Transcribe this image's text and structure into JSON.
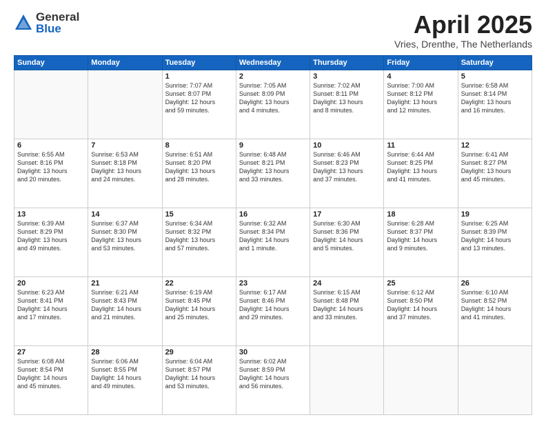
{
  "header": {
    "logo_general": "General",
    "logo_blue": "Blue",
    "month_title": "April 2025",
    "subtitle": "Vries, Drenthe, The Netherlands"
  },
  "days_of_week": [
    "Sunday",
    "Monday",
    "Tuesday",
    "Wednesday",
    "Thursday",
    "Friday",
    "Saturday"
  ],
  "weeks": [
    [
      {
        "day": "",
        "info": ""
      },
      {
        "day": "",
        "info": ""
      },
      {
        "day": "1",
        "info": "Sunrise: 7:07 AM\nSunset: 8:07 PM\nDaylight: 12 hours\nand 59 minutes."
      },
      {
        "day": "2",
        "info": "Sunrise: 7:05 AM\nSunset: 8:09 PM\nDaylight: 13 hours\nand 4 minutes."
      },
      {
        "day": "3",
        "info": "Sunrise: 7:02 AM\nSunset: 8:11 PM\nDaylight: 13 hours\nand 8 minutes."
      },
      {
        "day": "4",
        "info": "Sunrise: 7:00 AM\nSunset: 8:12 PM\nDaylight: 13 hours\nand 12 minutes."
      },
      {
        "day": "5",
        "info": "Sunrise: 6:58 AM\nSunset: 8:14 PM\nDaylight: 13 hours\nand 16 minutes."
      }
    ],
    [
      {
        "day": "6",
        "info": "Sunrise: 6:55 AM\nSunset: 8:16 PM\nDaylight: 13 hours\nand 20 minutes."
      },
      {
        "day": "7",
        "info": "Sunrise: 6:53 AM\nSunset: 8:18 PM\nDaylight: 13 hours\nand 24 minutes."
      },
      {
        "day": "8",
        "info": "Sunrise: 6:51 AM\nSunset: 8:20 PM\nDaylight: 13 hours\nand 28 minutes."
      },
      {
        "day": "9",
        "info": "Sunrise: 6:48 AM\nSunset: 8:21 PM\nDaylight: 13 hours\nand 33 minutes."
      },
      {
        "day": "10",
        "info": "Sunrise: 6:46 AM\nSunset: 8:23 PM\nDaylight: 13 hours\nand 37 minutes."
      },
      {
        "day": "11",
        "info": "Sunrise: 6:44 AM\nSunset: 8:25 PM\nDaylight: 13 hours\nand 41 minutes."
      },
      {
        "day": "12",
        "info": "Sunrise: 6:41 AM\nSunset: 8:27 PM\nDaylight: 13 hours\nand 45 minutes."
      }
    ],
    [
      {
        "day": "13",
        "info": "Sunrise: 6:39 AM\nSunset: 8:29 PM\nDaylight: 13 hours\nand 49 minutes."
      },
      {
        "day": "14",
        "info": "Sunrise: 6:37 AM\nSunset: 8:30 PM\nDaylight: 13 hours\nand 53 minutes."
      },
      {
        "day": "15",
        "info": "Sunrise: 6:34 AM\nSunset: 8:32 PM\nDaylight: 13 hours\nand 57 minutes."
      },
      {
        "day": "16",
        "info": "Sunrise: 6:32 AM\nSunset: 8:34 PM\nDaylight: 14 hours\nand 1 minute."
      },
      {
        "day": "17",
        "info": "Sunrise: 6:30 AM\nSunset: 8:36 PM\nDaylight: 14 hours\nand 5 minutes."
      },
      {
        "day": "18",
        "info": "Sunrise: 6:28 AM\nSunset: 8:37 PM\nDaylight: 14 hours\nand 9 minutes."
      },
      {
        "day": "19",
        "info": "Sunrise: 6:25 AM\nSunset: 8:39 PM\nDaylight: 14 hours\nand 13 minutes."
      }
    ],
    [
      {
        "day": "20",
        "info": "Sunrise: 6:23 AM\nSunset: 8:41 PM\nDaylight: 14 hours\nand 17 minutes."
      },
      {
        "day": "21",
        "info": "Sunrise: 6:21 AM\nSunset: 8:43 PM\nDaylight: 14 hours\nand 21 minutes."
      },
      {
        "day": "22",
        "info": "Sunrise: 6:19 AM\nSunset: 8:45 PM\nDaylight: 14 hours\nand 25 minutes."
      },
      {
        "day": "23",
        "info": "Sunrise: 6:17 AM\nSunset: 8:46 PM\nDaylight: 14 hours\nand 29 minutes."
      },
      {
        "day": "24",
        "info": "Sunrise: 6:15 AM\nSunset: 8:48 PM\nDaylight: 14 hours\nand 33 minutes."
      },
      {
        "day": "25",
        "info": "Sunrise: 6:12 AM\nSunset: 8:50 PM\nDaylight: 14 hours\nand 37 minutes."
      },
      {
        "day": "26",
        "info": "Sunrise: 6:10 AM\nSunset: 8:52 PM\nDaylight: 14 hours\nand 41 minutes."
      }
    ],
    [
      {
        "day": "27",
        "info": "Sunrise: 6:08 AM\nSunset: 8:54 PM\nDaylight: 14 hours\nand 45 minutes."
      },
      {
        "day": "28",
        "info": "Sunrise: 6:06 AM\nSunset: 8:55 PM\nDaylight: 14 hours\nand 49 minutes."
      },
      {
        "day": "29",
        "info": "Sunrise: 6:04 AM\nSunset: 8:57 PM\nDaylight: 14 hours\nand 53 minutes."
      },
      {
        "day": "30",
        "info": "Sunrise: 6:02 AM\nSunset: 8:59 PM\nDaylight: 14 hours\nand 56 minutes."
      },
      {
        "day": "",
        "info": ""
      },
      {
        "day": "",
        "info": ""
      },
      {
        "day": "",
        "info": ""
      }
    ]
  ]
}
